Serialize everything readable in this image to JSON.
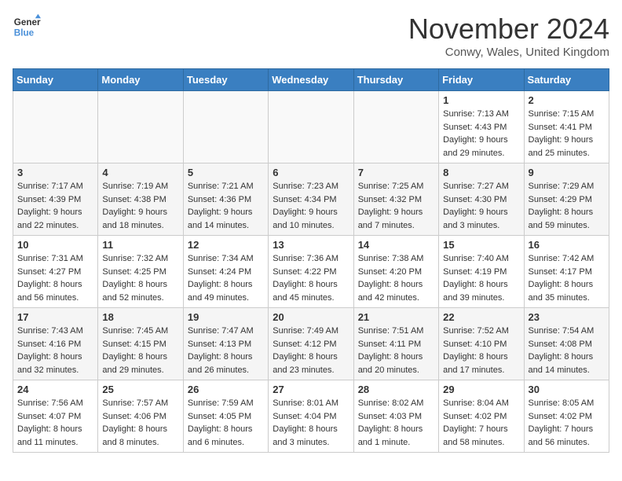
{
  "header": {
    "logo_line1": "General",
    "logo_line2": "Blue",
    "month": "November 2024",
    "location": "Conwy, Wales, United Kingdom"
  },
  "days_of_week": [
    "Sunday",
    "Monday",
    "Tuesday",
    "Wednesday",
    "Thursday",
    "Friday",
    "Saturday"
  ],
  "weeks": [
    [
      {
        "day": "",
        "info": ""
      },
      {
        "day": "",
        "info": ""
      },
      {
        "day": "",
        "info": ""
      },
      {
        "day": "",
        "info": ""
      },
      {
        "day": "",
        "info": ""
      },
      {
        "day": "1",
        "info": "Sunrise: 7:13 AM\nSunset: 4:43 PM\nDaylight: 9 hours and 29 minutes."
      },
      {
        "day": "2",
        "info": "Sunrise: 7:15 AM\nSunset: 4:41 PM\nDaylight: 9 hours and 25 minutes."
      }
    ],
    [
      {
        "day": "3",
        "info": "Sunrise: 7:17 AM\nSunset: 4:39 PM\nDaylight: 9 hours and 22 minutes."
      },
      {
        "day": "4",
        "info": "Sunrise: 7:19 AM\nSunset: 4:38 PM\nDaylight: 9 hours and 18 minutes."
      },
      {
        "day": "5",
        "info": "Sunrise: 7:21 AM\nSunset: 4:36 PM\nDaylight: 9 hours and 14 minutes."
      },
      {
        "day": "6",
        "info": "Sunrise: 7:23 AM\nSunset: 4:34 PM\nDaylight: 9 hours and 10 minutes."
      },
      {
        "day": "7",
        "info": "Sunrise: 7:25 AM\nSunset: 4:32 PM\nDaylight: 9 hours and 7 minutes."
      },
      {
        "day": "8",
        "info": "Sunrise: 7:27 AM\nSunset: 4:30 PM\nDaylight: 9 hours and 3 minutes."
      },
      {
        "day": "9",
        "info": "Sunrise: 7:29 AM\nSunset: 4:29 PM\nDaylight: 8 hours and 59 minutes."
      }
    ],
    [
      {
        "day": "10",
        "info": "Sunrise: 7:31 AM\nSunset: 4:27 PM\nDaylight: 8 hours and 56 minutes."
      },
      {
        "day": "11",
        "info": "Sunrise: 7:32 AM\nSunset: 4:25 PM\nDaylight: 8 hours and 52 minutes."
      },
      {
        "day": "12",
        "info": "Sunrise: 7:34 AM\nSunset: 4:24 PM\nDaylight: 8 hours and 49 minutes."
      },
      {
        "day": "13",
        "info": "Sunrise: 7:36 AM\nSunset: 4:22 PM\nDaylight: 8 hours and 45 minutes."
      },
      {
        "day": "14",
        "info": "Sunrise: 7:38 AM\nSunset: 4:20 PM\nDaylight: 8 hours and 42 minutes."
      },
      {
        "day": "15",
        "info": "Sunrise: 7:40 AM\nSunset: 4:19 PM\nDaylight: 8 hours and 39 minutes."
      },
      {
        "day": "16",
        "info": "Sunrise: 7:42 AM\nSunset: 4:17 PM\nDaylight: 8 hours and 35 minutes."
      }
    ],
    [
      {
        "day": "17",
        "info": "Sunrise: 7:43 AM\nSunset: 4:16 PM\nDaylight: 8 hours and 32 minutes."
      },
      {
        "day": "18",
        "info": "Sunrise: 7:45 AM\nSunset: 4:15 PM\nDaylight: 8 hours and 29 minutes."
      },
      {
        "day": "19",
        "info": "Sunrise: 7:47 AM\nSunset: 4:13 PM\nDaylight: 8 hours and 26 minutes."
      },
      {
        "day": "20",
        "info": "Sunrise: 7:49 AM\nSunset: 4:12 PM\nDaylight: 8 hours and 23 minutes."
      },
      {
        "day": "21",
        "info": "Sunrise: 7:51 AM\nSunset: 4:11 PM\nDaylight: 8 hours and 20 minutes."
      },
      {
        "day": "22",
        "info": "Sunrise: 7:52 AM\nSunset: 4:10 PM\nDaylight: 8 hours and 17 minutes."
      },
      {
        "day": "23",
        "info": "Sunrise: 7:54 AM\nSunset: 4:08 PM\nDaylight: 8 hours and 14 minutes."
      }
    ],
    [
      {
        "day": "24",
        "info": "Sunrise: 7:56 AM\nSunset: 4:07 PM\nDaylight: 8 hours and 11 minutes."
      },
      {
        "day": "25",
        "info": "Sunrise: 7:57 AM\nSunset: 4:06 PM\nDaylight: 8 hours and 8 minutes."
      },
      {
        "day": "26",
        "info": "Sunrise: 7:59 AM\nSunset: 4:05 PM\nDaylight: 8 hours and 6 minutes."
      },
      {
        "day": "27",
        "info": "Sunrise: 8:01 AM\nSunset: 4:04 PM\nDaylight: 8 hours and 3 minutes."
      },
      {
        "day": "28",
        "info": "Sunrise: 8:02 AM\nSunset: 4:03 PM\nDaylight: 8 hours and 1 minute."
      },
      {
        "day": "29",
        "info": "Sunrise: 8:04 AM\nSunset: 4:02 PM\nDaylight: 7 hours and 58 minutes."
      },
      {
        "day": "30",
        "info": "Sunrise: 8:05 AM\nSunset: 4:02 PM\nDaylight: 7 hours and 56 minutes."
      }
    ]
  ]
}
